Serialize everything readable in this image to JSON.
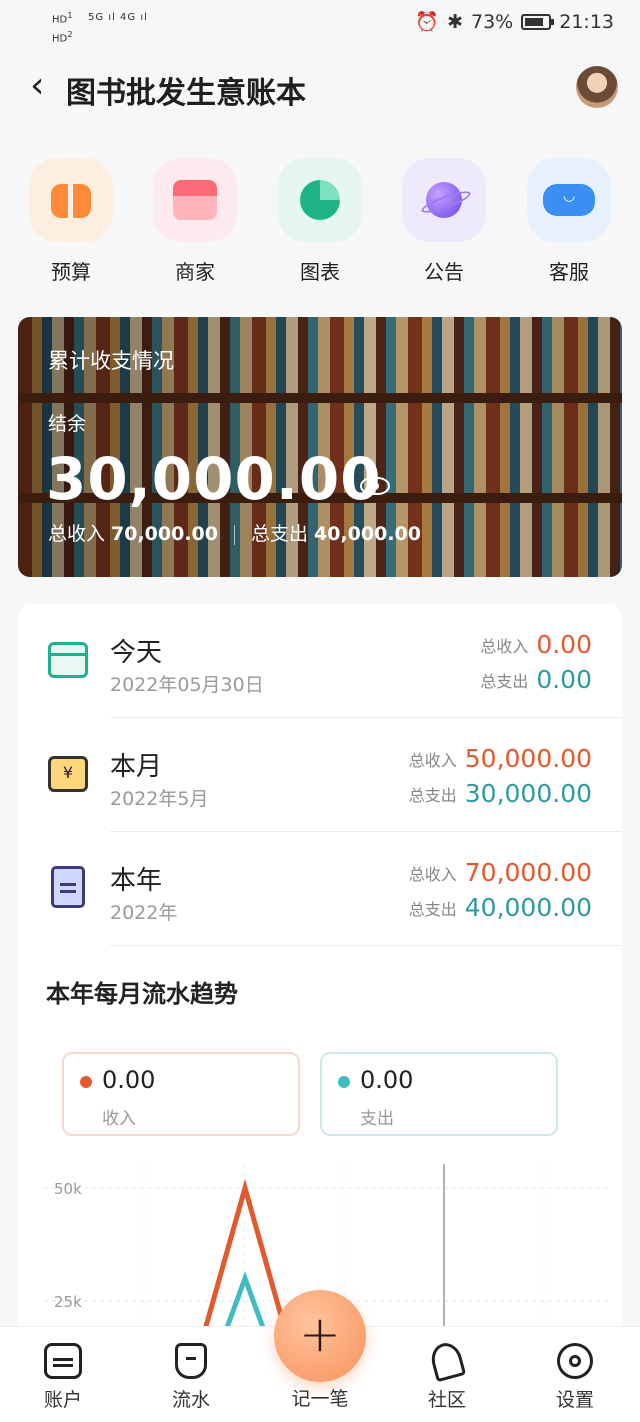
{
  "status_bar": {
    "sim": "HD 1\nHD 2",
    "signal": "5G ıl 4G ıl",
    "battery": "73%",
    "time": "21:13"
  },
  "nav": {
    "title": "图书批发生意账本"
  },
  "quick_actions": [
    {
      "label": "预算",
      "icon": "budget-icon"
    },
    {
      "label": "商家",
      "icon": "shop-icon"
    },
    {
      "label": "图表",
      "icon": "pie-chart-icon"
    },
    {
      "label": "公告",
      "icon": "planet-icon"
    },
    {
      "label": "客服",
      "icon": "customer-service-icon"
    }
  ],
  "summary_card": {
    "title": "累计收支情况",
    "balance_label": "结余",
    "balance": "30,000.00",
    "income_label": "总收入",
    "income": "70,000.00",
    "expense_label": "总支出",
    "expense": "40,000.00"
  },
  "periods": [
    {
      "title": "今天",
      "date": "2022年05月30日",
      "income_label": "总收入",
      "income": "0.00",
      "expense_label": "总支出",
      "expense": "0.00",
      "icon": "calendar-icon"
    },
    {
      "title": "本月",
      "date": "2022年5月",
      "income_label": "总收入",
      "income": "50,000.00",
      "expense_label": "总支出",
      "expense": "30,000.00",
      "icon": "yen-calendar-icon"
    },
    {
      "title": "本年",
      "date": "2022年",
      "income_label": "总收入",
      "income": "70,000.00",
      "expense_label": "总支出",
      "expense": "40,000.00",
      "icon": "document-icon"
    }
  ],
  "trend": {
    "title": "本年每月流水趋势",
    "income_value": "0.00",
    "income_label": "收入",
    "expense_value": "0.00",
    "expense_label": "支出"
  },
  "chart_data": {
    "type": "line",
    "y_ticks": [
      "50k",
      "25k"
    ],
    "ylim": [
      0,
      50000
    ],
    "series": [
      {
        "name": "收入",
        "color": "#e2582f",
        "peak": 50000
      },
      {
        "name": "支出",
        "color": "#3fbcbf",
        "peak": 30000
      }
    ]
  },
  "tabbar": {
    "items": [
      {
        "label": "账户",
        "icon": "account-icon"
      },
      {
        "label": "流水",
        "icon": "flow-icon"
      },
      {
        "label": "记一笔",
        "icon": "plus-icon"
      },
      {
        "label": "社区",
        "icon": "community-icon"
      },
      {
        "label": "设置",
        "icon": "settings-icon"
      }
    ]
  }
}
